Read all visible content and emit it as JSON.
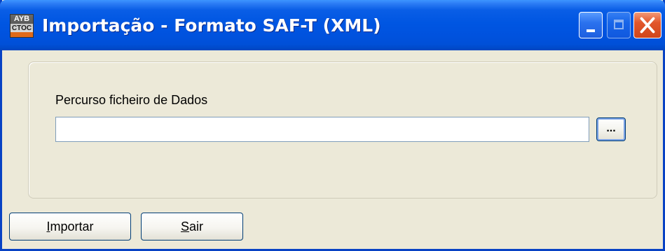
{
  "window": {
    "title": "Importação - Formato SAF-T (XML)",
    "icon": "app-logo-icon",
    "icon_text_top": "AYB",
    "icon_text_bottom": "CTOC",
    "controls": [
      "minimize-icon",
      "maximize-icon",
      "close-icon"
    ]
  },
  "form": {
    "path_label": "Percurso ficheiro de Dados",
    "path_value": "",
    "browse_label": "..."
  },
  "buttons": {
    "import_mnemonic": "I",
    "import_rest": "mportar",
    "exit_mnemonic": "S",
    "exit_rest": "air"
  },
  "colors": {
    "titlebar": "#0056e2",
    "window_bg": "#ece9d8",
    "close_button": "#e2562b",
    "button_border": "#003c74"
  }
}
